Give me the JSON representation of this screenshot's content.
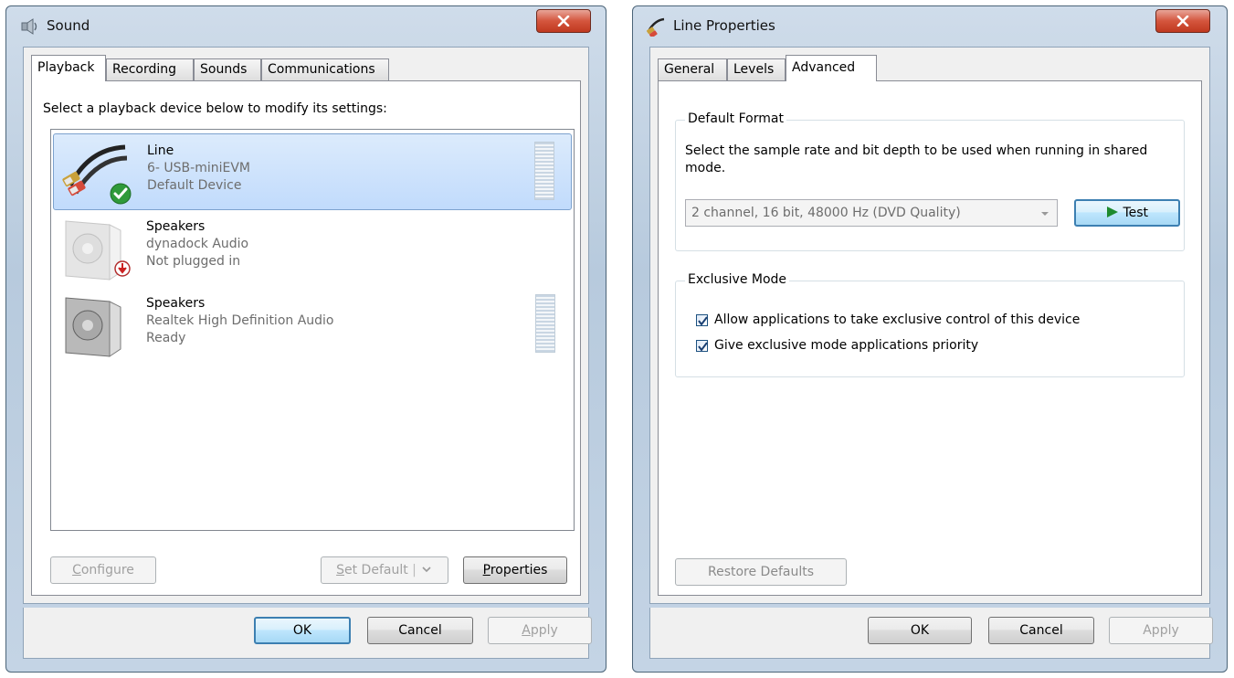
{
  "sound_window": {
    "title": "Sound",
    "tabs": [
      "Playback",
      "Recording",
      "Sounds",
      "Communications"
    ],
    "active_tab": "Playback",
    "instruction": "Select a playback device below to modify its settings:",
    "devices": [
      {
        "name": "Line",
        "detail": "6- USB-miniEVM",
        "status": "Default Device",
        "icon": "line-cable-icon",
        "badge": "default-check-icon"
      },
      {
        "name": "Speakers",
        "detail": "dynadock Audio",
        "status": "Not plugged in",
        "icon": "speaker-icon",
        "badge": "unplugged-arrow-icon"
      },
      {
        "name": "Speakers",
        "detail": "Realtek High Definition Audio",
        "status": "Ready",
        "icon": "speaker-icon",
        "badge": ""
      }
    ],
    "buttons": {
      "configure_prefix": "C",
      "configure_rest": "onfigure",
      "set_default_prefix": "S",
      "set_default_rest": "et Default",
      "properties_prefix": "P",
      "properties_rest": "roperties",
      "ok": "OK",
      "cancel": "Cancel",
      "apply_prefix": "A",
      "apply_rest": "pply"
    }
  },
  "line_window": {
    "title": "Line Properties",
    "tabs": [
      "General",
      "Levels",
      "Advanced"
    ],
    "active_tab": "Advanced",
    "default_format": {
      "title": "Default Format",
      "description": "Select the sample rate and bit depth to be used when running in shared mode.",
      "selected_format": "2 channel, 16 bit, 48000 Hz (DVD Quality)",
      "test_label": "Test"
    },
    "exclusive_mode": {
      "title": "Exclusive Mode",
      "options": [
        {
          "label": "Allow applications to take exclusive control of this device",
          "checked": true
        },
        {
          "label": "Give exclusive mode applications priority",
          "checked": true
        }
      ]
    },
    "buttons": {
      "restore_defaults": "Restore Defaults",
      "ok": "OK",
      "cancel": "Cancel",
      "apply": "Apply"
    }
  },
  "colors": {
    "selection": "#c1dbfc",
    "close_red": "#c0391f",
    "test_arrow": "#1e8a2e"
  }
}
